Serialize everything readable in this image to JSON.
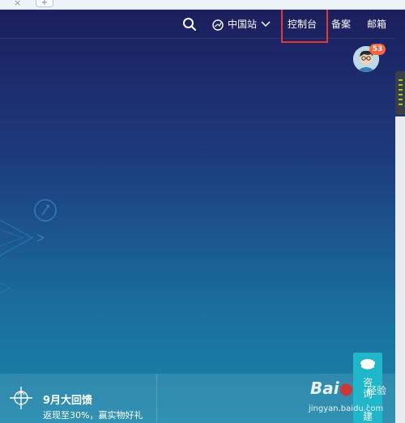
{
  "browser": {
    "tab_close": "×",
    "new_tab": "+"
  },
  "nav": {
    "region": "中国站",
    "console": "控制台",
    "record": "备案",
    "mail": "邮箱"
  },
  "user": {
    "notification_count": "53"
  },
  "promo": {
    "title": "9月大回馈",
    "subtitle": "返现至30%，赢实物好礼"
  },
  "consult": {
    "chars": [
      "咨",
      "询",
      "·",
      "建"
    ]
  },
  "watermark": {
    "logo_prefix": "Bai",
    "logo_paw": "",
    "logo_suffix": "",
    "text": "经验",
    "url": "jingyan.baidu.com"
  },
  "colors": {
    "highlight": "#e53935",
    "badge": "#f5633f",
    "consult": "#1fb7c9"
  }
}
